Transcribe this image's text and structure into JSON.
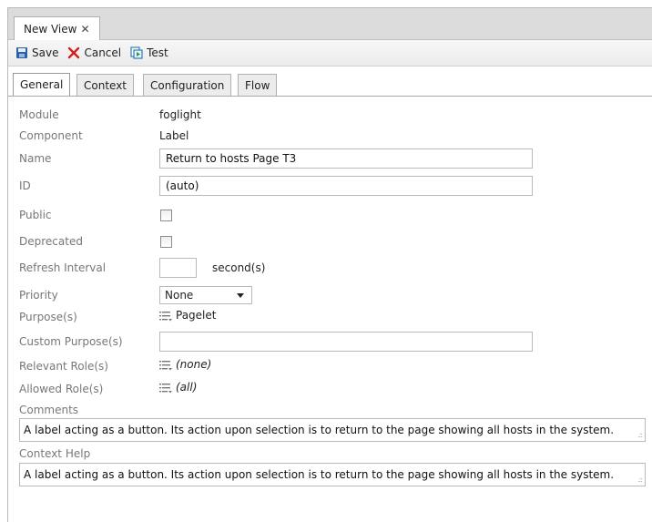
{
  "view_tab": {
    "label": "New View",
    "close": "✕"
  },
  "toolbar": {
    "save": "Save",
    "cancel": "Cancel",
    "test": "Test"
  },
  "subtabs": [
    "General",
    "Context",
    "Configuration",
    "Flow"
  ],
  "form": {
    "module_label": "Module",
    "module_value": "foglight",
    "component_label": "Component",
    "component_value": "Label",
    "name_label": "Name",
    "name_value": "Return to hosts Page T3",
    "id_label": "ID",
    "id_value": "(auto)",
    "public_label": "Public",
    "public_checked": false,
    "deprecated_label": "Deprecated",
    "deprecated_checked": false,
    "refresh_label": "Refresh Interval",
    "refresh_value": "",
    "refresh_unit": "second(s)",
    "priority_label": "Priority",
    "priority_value": "None",
    "purpose_label": "Purpose(s)",
    "purpose_value": "Pagelet",
    "custom_purpose_label": "Custom Purpose(s)",
    "custom_purpose_value": "",
    "relevant_role_label": "Relevant Role(s)",
    "relevant_role_value": "(none)",
    "allowed_role_label": "Allowed Role(s)",
    "allowed_role_value": "(all)",
    "comments_label": "Comments",
    "comments_value": "A label acting as a button. Its action upon selection is to return to the page showing all hosts in the system.",
    "context_help_label": "Context Help",
    "context_help_value": "A label acting as a button. Its action upon selection is to return to the page showing all hosts in the system."
  },
  "colors": {
    "save_icon": "#2b5fa8",
    "cancel_icon": "#d21f1f",
    "test_icon": "#2c7fb8"
  },
  "icons": {
    "save": "floppy-disk-icon",
    "cancel": "x-icon",
    "test": "test-run-icon",
    "list": "list-select-icon"
  }
}
